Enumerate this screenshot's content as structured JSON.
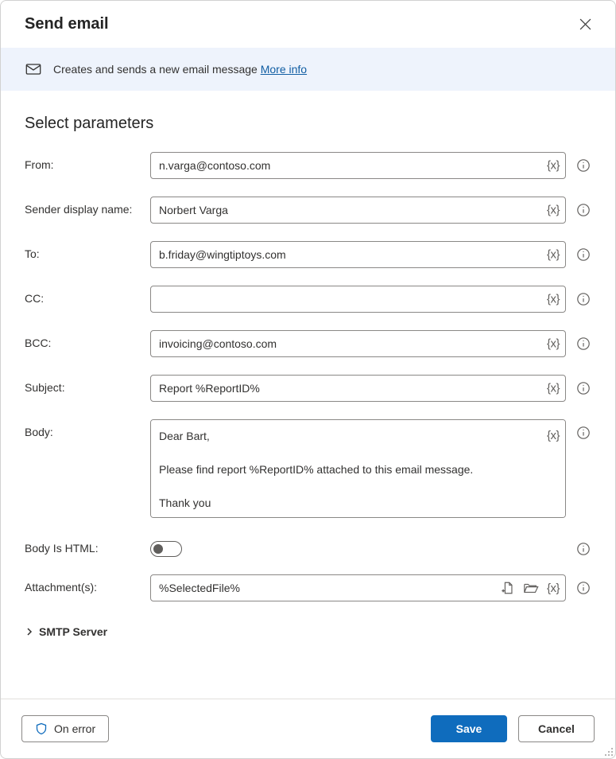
{
  "dialog": {
    "title": "Send email",
    "banner_text": "Creates and sends a new email message ",
    "banner_link": "More info",
    "section_title": "Select parameters"
  },
  "fields": {
    "from": {
      "label": "From:",
      "value": "n.varga@contoso.com"
    },
    "sender_display": {
      "label": "Sender display name:",
      "value": "Norbert Varga"
    },
    "to": {
      "label": "To:",
      "value": "b.friday@wingtiptoys.com"
    },
    "cc": {
      "label": "CC:",
      "value": ""
    },
    "bcc": {
      "label": "BCC:",
      "value": "invoicing@contoso.com"
    },
    "subject": {
      "label": "Subject:",
      "value": "Report %ReportID%"
    },
    "body": {
      "label": "Body:",
      "value": "Dear Bart,\n\nPlease find report %ReportID% attached to this email message.\n\nThank you"
    },
    "body_is_html": {
      "label": "Body Is HTML:",
      "value": false
    },
    "attachments": {
      "label": "Attachment(s):",
      "value": "%SelectedFile%"
    }
  },
  "expander": {
    "label": "SMTP Server"
  },
  "footer": {
    "on_error": "On error",
    "save": "Save",
    "cancel": "Cancel"
  },
  "tokens": {
    "variable": "{x}"
  }
}
